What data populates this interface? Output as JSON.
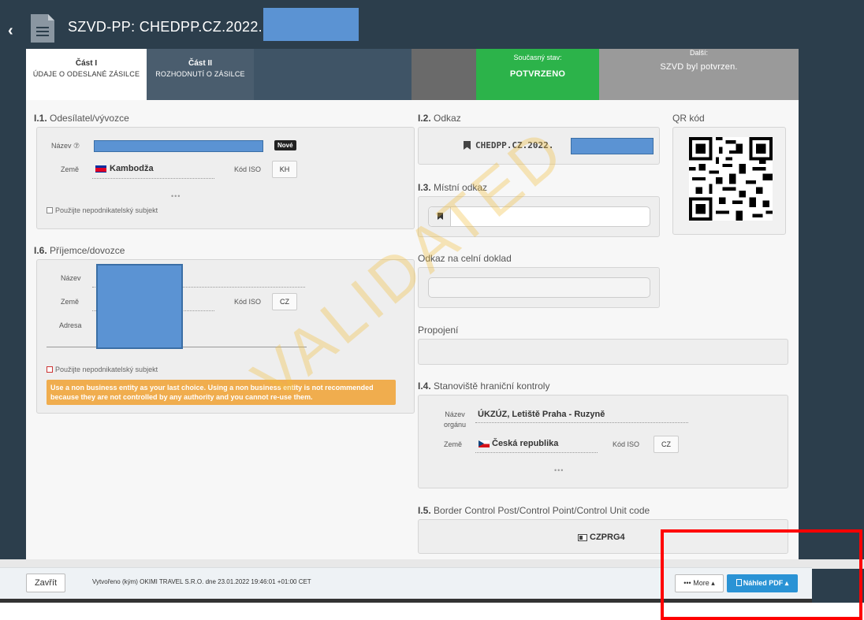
{
  "header": {
    "title": "SZVD-PP: CHEDPP.CZ.2022.",
    "back_label": "‹"
  },
  "tabs": [
    {
      "line1": "Část I",
      "line2": "Údaje o odeslané zásilce"
    },
    {
      "line1": "Část II",
      "line2": "Rozhodnutí o zásilce"
    }
  ],
  "status": {
    "label": "Současný stav:",
    "value": "POTVRZENO",
    "next_label": "Další:",
    "next_value": "SZVD byl potvrzen."
  },
  "consignor": {
    "section_num": "I.1.",
    "section_title": "Odesílatel/vývozce",
    "name_label": "Název ⑦",
    "new_badge": "Nové",
    "country_label": "Země",
    "country_value": "Kambodža",
    "iso_label": "Kód ISO",
    "iso_value": "KH",
    "more": "•••",
    "nonbusiness_label": "Použijte nepodnikatelský subjekt"
  },
  "consignee": {
    "section_num": "I.6.",
    "section_title": "Příjemce/dovozce",
    "name_label": "Název",
    "country_label": "Země",
    "iso_label": "Kód ISO",
    "iso_value": "CZ",
    "address_label": "Adresa",
    "nonbusiness_label": "Použijte nepodnikatelský subjekt",
    "warning": "Use a non business entity as your last choice. Using a non business entity is not recommended because they are not controlled by any authority and you cannot re-use them."
  },
  "reference": {
    "section_num": "I.2.",
    "section_title": "Odkaz",
    "value": "CHEDPP.CZ.2022."
  },
  "local_reference": {
    "section_num": "I.3.",
    "section_title": "Místní odkaz",
    "value": ""
  },
  "customs_ref": {
    "title": "Odkaz na celní doklad",
    "value": ""
  },
  "linking": {
    "title": "Propojení"
  },
  "qr": {
    "title": "QR kód"
  },
  "bip": {
    "section_num": "I.4.",
    "section_title": "Stanoviště hraniční kontroly",
    "org_label": "Název orgánu",
    "org_value": "ÚKZÚZ, Letiště Praha - Ruzyně",
    "country_label": "Země",
    "country_value": "Česká republika",
    "iso_label": "Kód ISO",
    "iso_value": "CZ",
    "more": "•••"
  },
  "bcp": {
    "section_num": "I.5.",
    "section_title": "Border Control Post/Control Point/Control Unit code",
    "value": "CZPRG4"
  },
  "watermark": "VALIDATED",
  "footer": {
    "close_label": "Zavřít",
    "created_text": "Vytvořeno (kým) OKIMI TRAVEL S.R.O. dne 23.01.2022 19:46:01 +01:00 CET",
    "more_label": "••• More ▴",
    "pdf_label": "Náhled PDF ▴"
  },
  "colors": {
    "status_green": "#2cb34a",
    "header_dark": "#2c3e4c",
    "pdf_blue": "#2a93d5",
    "warning_orange": "#f0ad4e",
    "highlight_red": "#ff0000",
    "redaction_blue": "#5b93d3"
  }
}
